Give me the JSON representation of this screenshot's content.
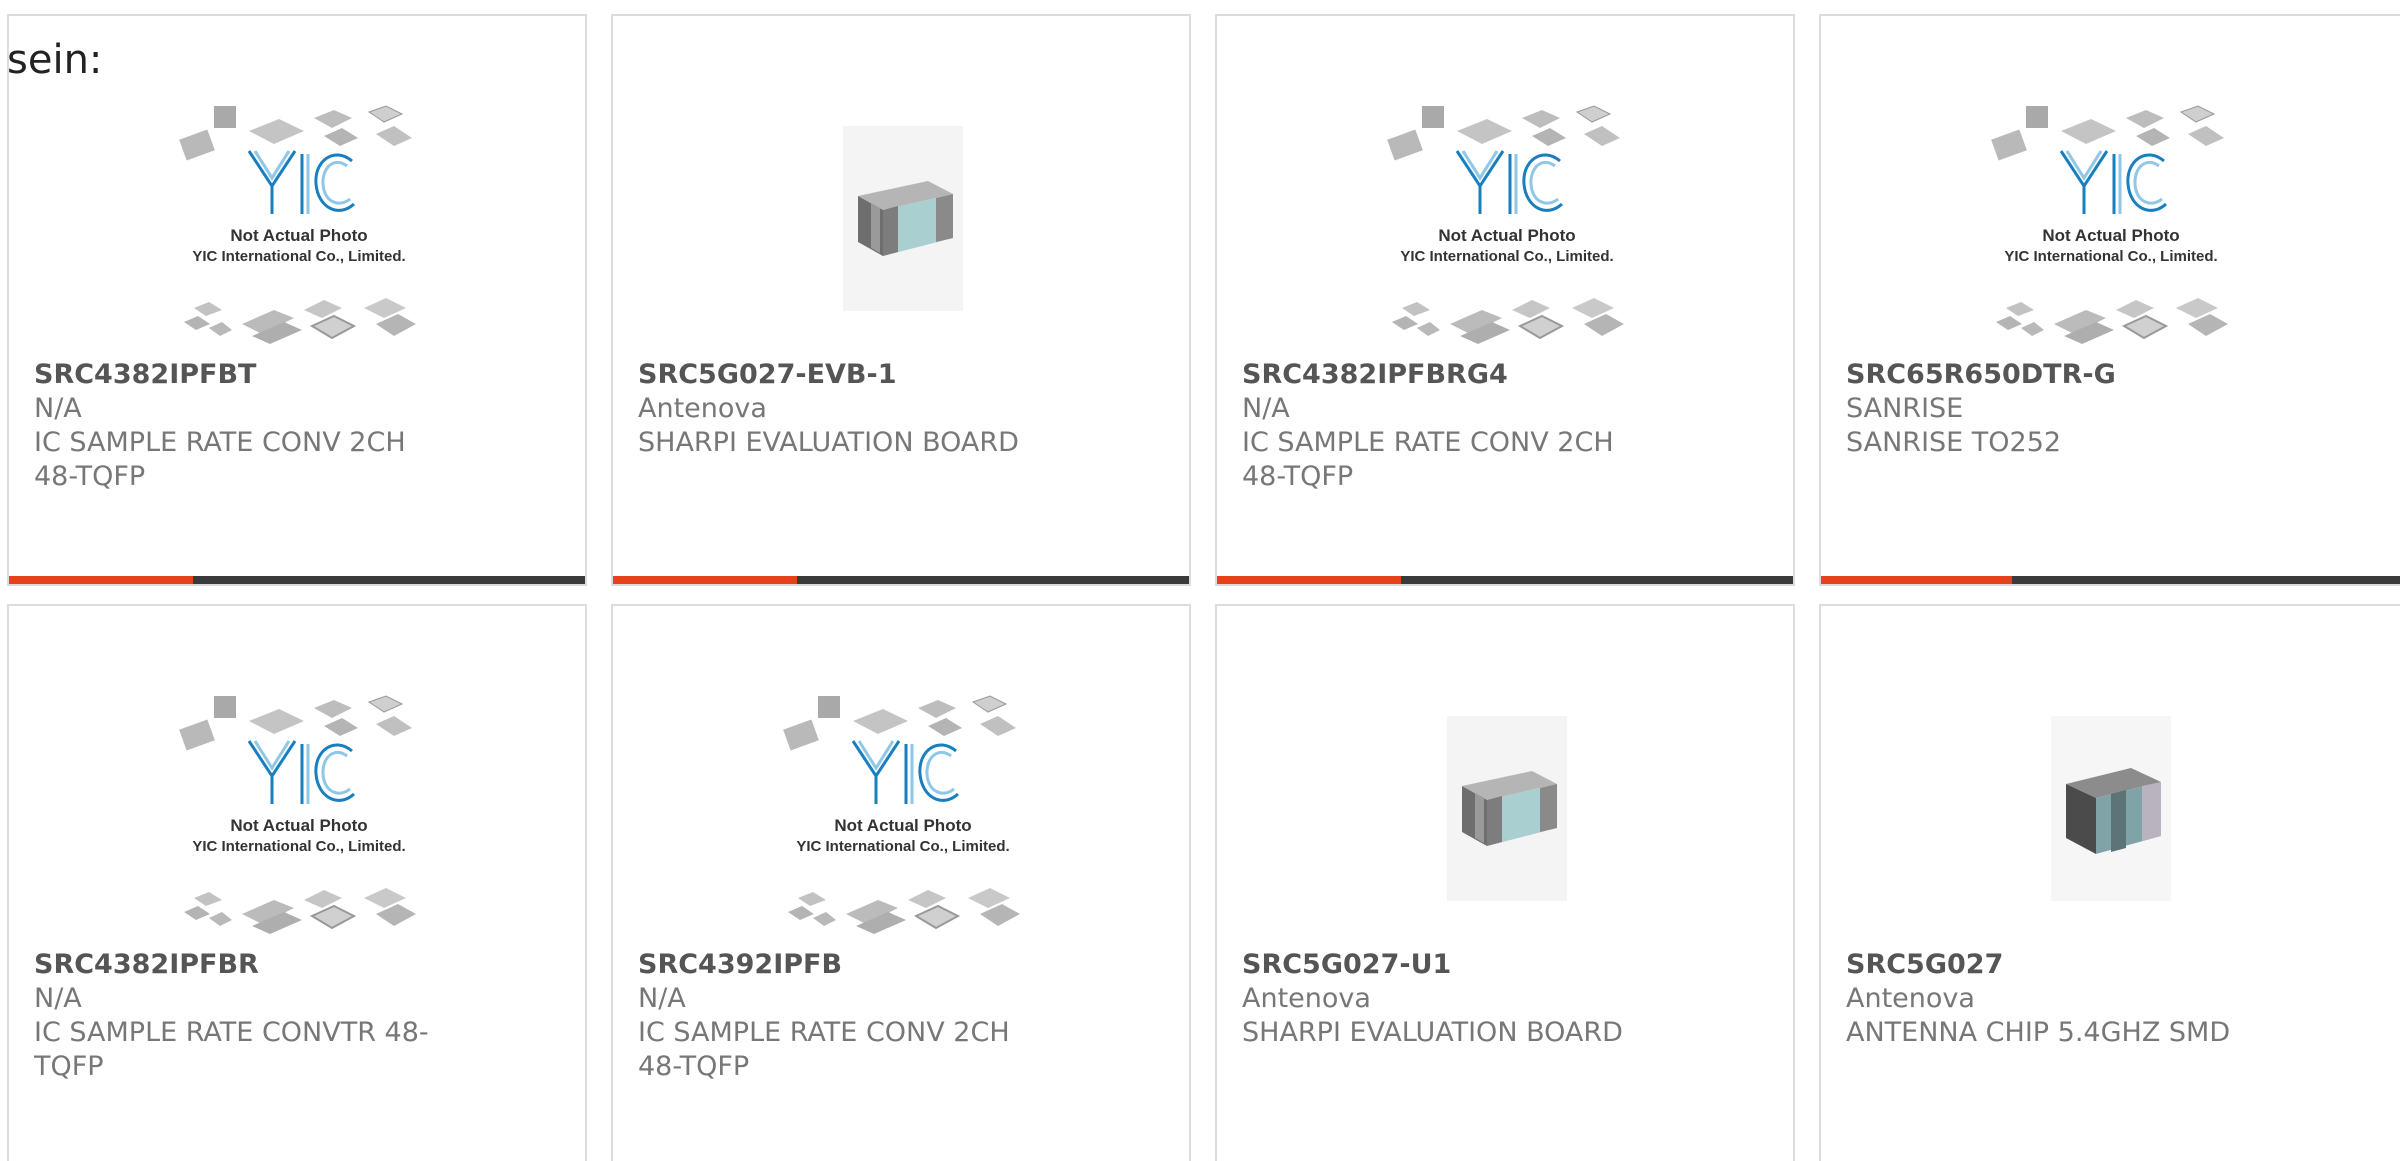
{
  "lead_text": "sein:",
  "colors": {
    "accent": "#e5411b",
    "bar_track": "#3a3a3a",
    "border": "#dcdcdc",
    "logo_blue": "#1a7fbf"
  },
  "placeholder_image": {
    "line1": "Not Actual Photo",
    "line2": "YIC International Co., Limited.",
    "logo": "YIC"
  },
  "products": [
    {
      "part_no": "SRC4382IPFBT",
      "maker": "N/A",
      "desc": "IC SAMPLE RATE CONV 2CH 48-TQFP",
      "image": "yic-placeholder",
      "progress": 0.32
    },
    {
      "part_no": "SRC5G027-EVB-1",
      "maker": "Antenova",
      "desc": "SHARPI EVALUATION BOARD",
      "image": "chip-component",
      "progress": 0.32
    },
    {
      "part_no": "SRC4382IPFBRG4",
      "maker": "N/A",
      "desc": "IC SAMPLE RATE CONV 2CH 48-TQFP",
      "image": "yic-placeholder",
      "progress": 0.32
    },
    {
      "part_no": "SRC65R650DTR-G",
      "maker": "SANRISE",
      "desc": "SANRISE TO252",
      "image": "yic-placeholder",
      "progress": 0.32
    },
    {
      "part_no": "SRC4382IPFBR",
      "maker": "N/A",
      "desc": "IC SAMPLE RATE CONVTR 48-TQFP",
      "image": "yic-placeholder"
    },
    {
      "part_no": "SRC4392IPFB",
      "maker": "N/A",
      "desc": "IC SAMPLE RATE CONV 2CH 48-TQFP",
      "image": "yic-placeholder"
    },
    {
      "part_no": "SRC5G027-U1",
      "maker": "Antenova",
      "desc": "SHARPI EVALUATION BOARD",
      "image": "chip-component"
    },
    {
      "part_no": "SRC5G027",
      "maker": "Antenova",
      "desc": "ANTENNA CHIP 5.4GHZ SMD",
      "image": "chip-component-dark"
    }
  ]
}
